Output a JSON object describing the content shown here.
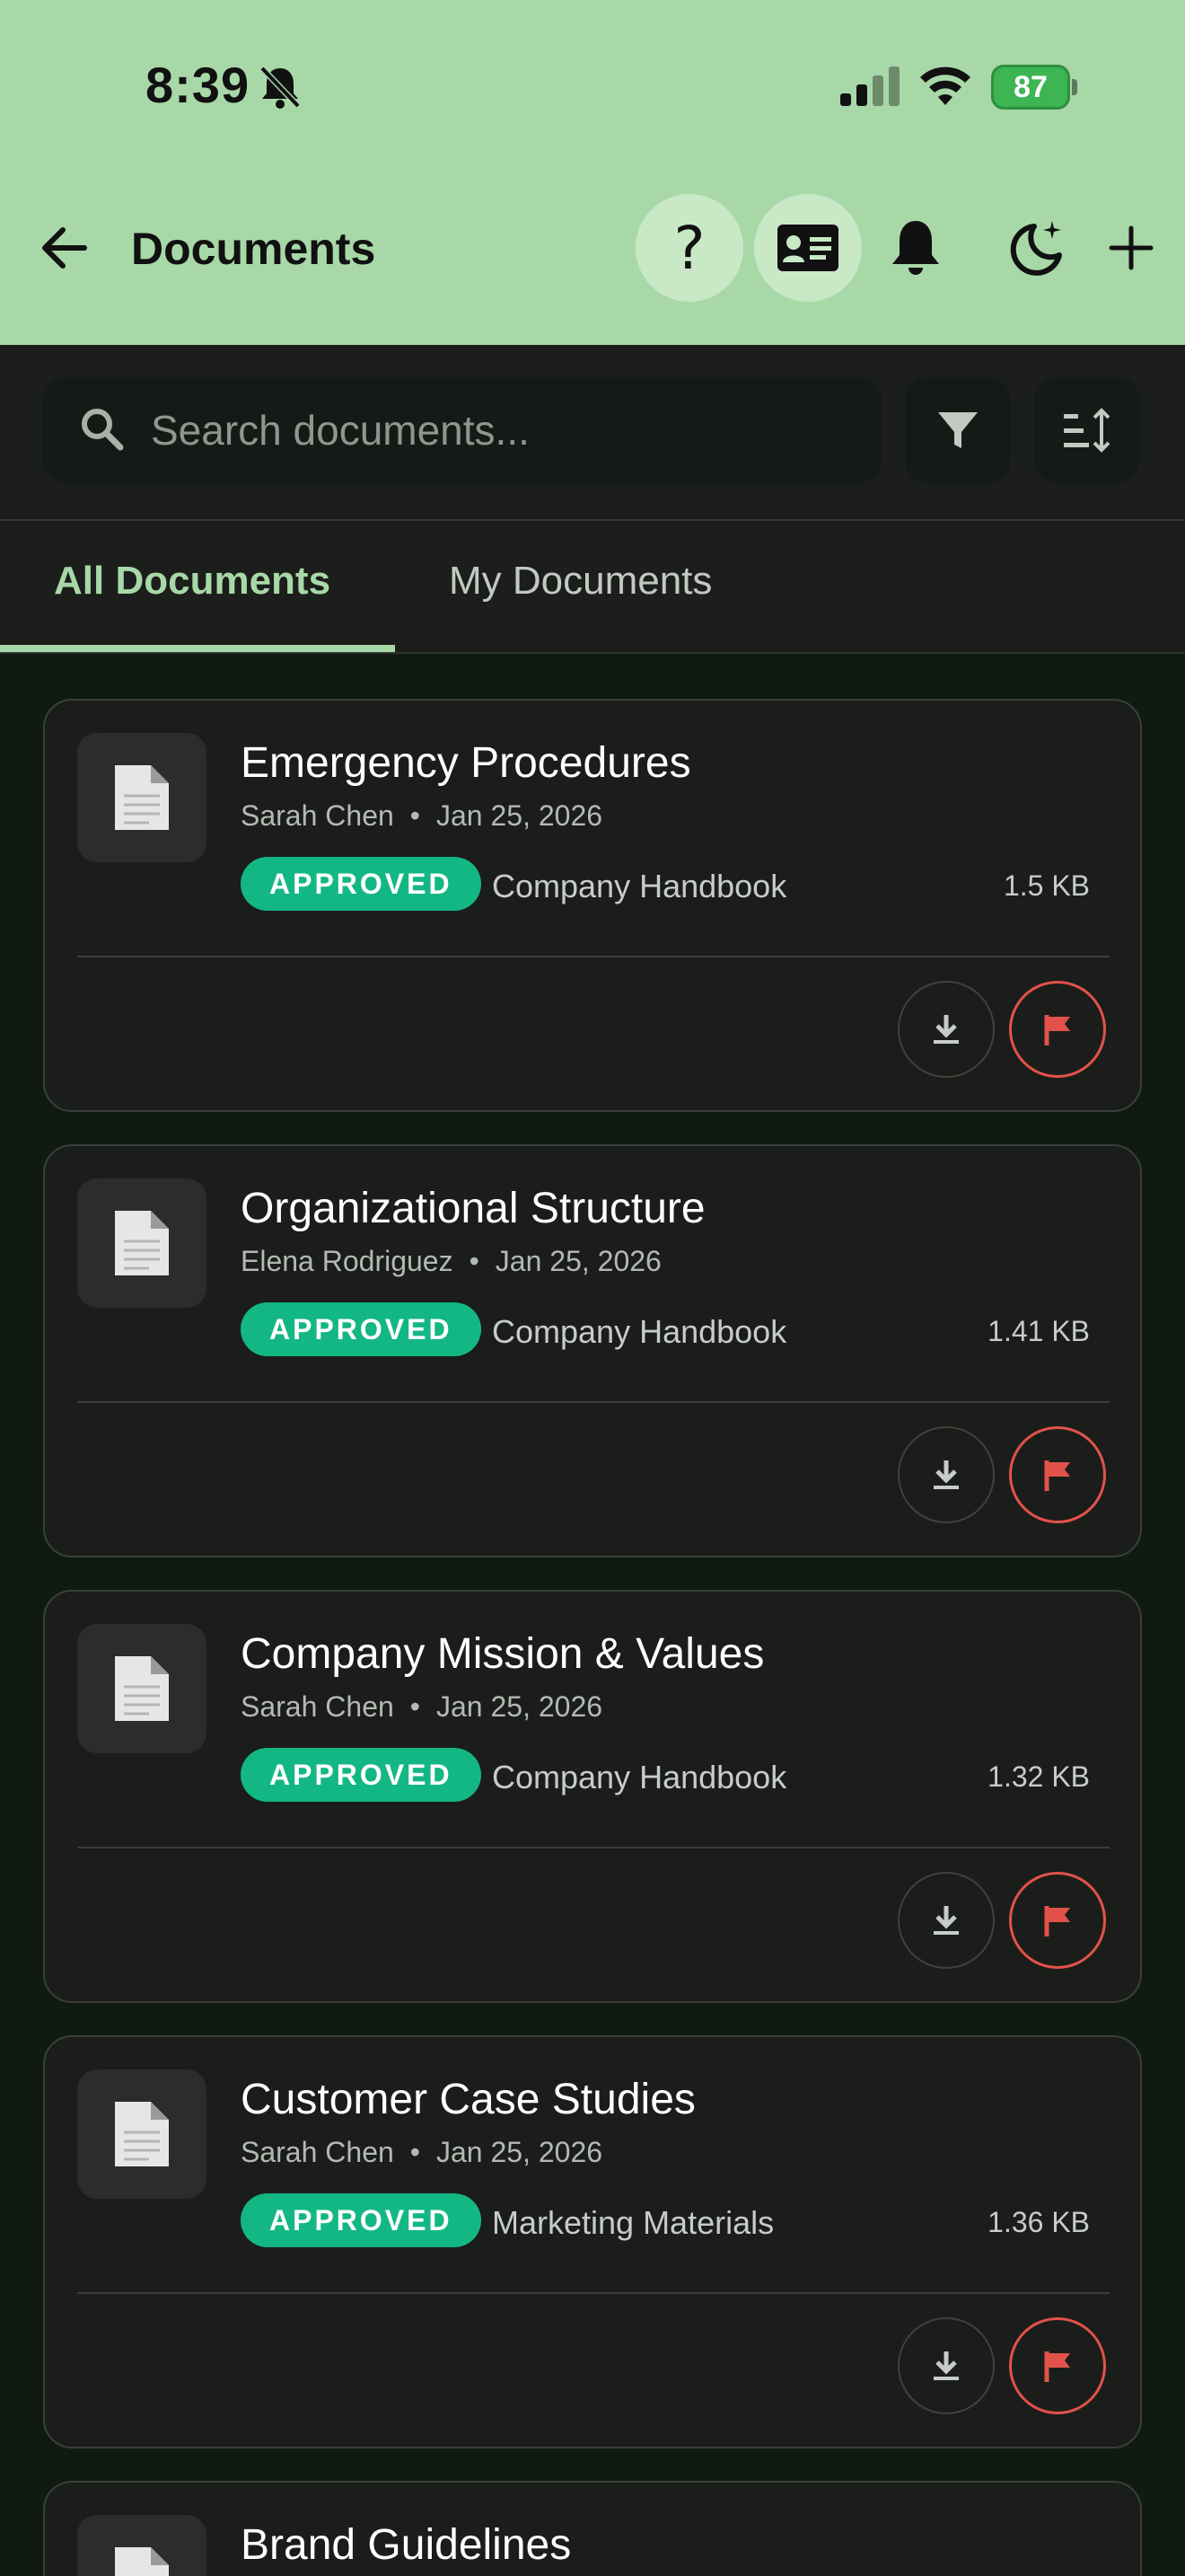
{
  "status_bar": {
    "time": "8:39",
    "battery": "87"
  },
  "header": {
    "title": "Documents"
  },
  "search": {
    "placeholder": "Search documents..."
  },
  "tabs": [
    {
      "label": "All Documents",
      "active": true
    },
    {
      "label": "My Documents",
      "active": false
    }
  ],
  "colors": {
    "header_bg": "#a8d8a8",
    "accent": "#a8d8a8",
    "badge": "#13b784",
    "flag": "#e2524a"
  },
  "documents": [
    {
      "title": "Emergency Procedures",
      "author": "Sarah Chen",
      "date": "Jan 25, 2026",
      "status": "APPROVED",
      "category": "Company Handbook",
      "size": "1.5 KB"
    },
    {
      "title": "Organizational Structure",
      "author": "Elena Rodriguez",
      "date": "Jan 25, 2026",
      "status": "APPROVED",
      "category": "Company Handbook",
      "size": "1.41 KB"
    },
    {
      "title": "Company Mission & Values",
      "author": "Sarah Chen",
      "date": "Jan 25, 2026",
      "status": "APPROVED",
      "category": "Company Handbook",
      "size": "1.32 KB"
    },
    {
      "title": "Customer Case Studies",
      "author": "Sarah Chen",
      "date": "Jan 25, 2026",
      "status": "APPROVED",
      "category": "Marketing Materials",
      "size": "1.36 KB"
    },
    {
      "title": "Brand Guidelines"
    }
  ],
  "icons": {
    "back": "arrow-left-icon",
    "help": "help-icon",
    "id_card": "id-card-icon",
    "notifications": "bell-icon",
    "theme": "moon-stars-icon",
    "add": "plus-icon",
    "search": "search-icon",
    "filter": "filter-icon",
    "sort": "sort-icon",
    "document": "document-icon",
    "download": "download-icon",
    "flag": "flag-icon"
  }
}
